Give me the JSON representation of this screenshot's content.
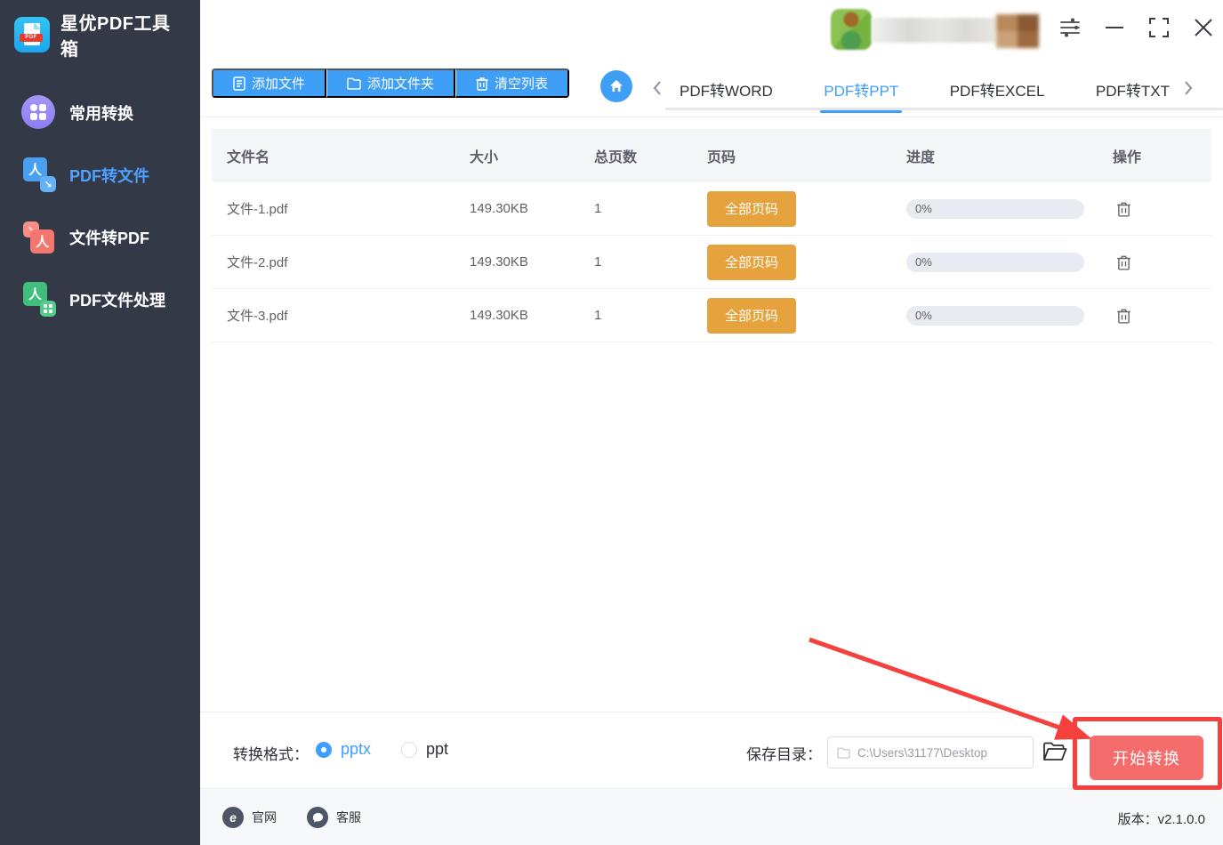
{
  "app": {
    "title": "星优PDF工具箱"
  },
  "sidebar": {
    "items": [
      {
        "label": "常用转换"
      },
      {
        "label": "PDF转文件"
      },
      {
        "label": "文件转PDF"
      },
      {
        "label": "PDF文件处理"
      }
    ],
    "active_item": "PDF转文件"
  },
  "toolbar": {
    "add_file": "添加文件",
    "add_folder": "添加文件夹",
    "clear_list": "清空列表"
  },
  "tabs": {
    "items": [
      "PDF转WORD",
      "PDF转PPT",
      "PDF转EXCEL",
      "PDF转TXT"
    ],
    "active": "PDF转PPT"
  },
  "table": {
    "headers": [
      "文件名",
      "大小",
      "总页数",
      "页码",
      "进度",
      "操作"
    ],
    "rows": [
      {
        "name": "文件-1.pdf",
        "size": "149.30KB",
        "pages": "1",
        "page_range": "全部页码",
        "progress": "0%"
      },
      {
        "name": "文件-2.pdf",
        "size": "149.30KB",
        "pages": "1",
        "page_range": "全部页码",
        "progress": "0%"
      },
      {
        "name": "文件-3.pdf",
        "size": "149.30KB",
        "pages": "1",
        "page_range": "全部页码",
        "progress": "0%"
      }
    ]
  },
  "bottom_bar": {
    "format_label": "转换格式：",
    "format_options": [
      {
        "label": "pptx",
        "selected": true
      },
      {
        "label": "ppt",
        "selected": false
      }
    ],
    "save_label": "保存目录：",
    "save_path": "C:\\Users\\31177\\Desktop",
    "start_label": "开始转换"
  },
  "footer": {
    "site_label": "官网",
    "support_label": "客服",
    "version_label": "版本：",
    "version": "v2.1.0.0"
  },
  "colors": {
    "primary_blue": "#409EFF",
    "warning_orange": "#E6A23C",
    "danger_red": "#F56C6C",
    "annotation_red": "#F5413D",
    "sidebar_bg": "#343948"
  }
}
